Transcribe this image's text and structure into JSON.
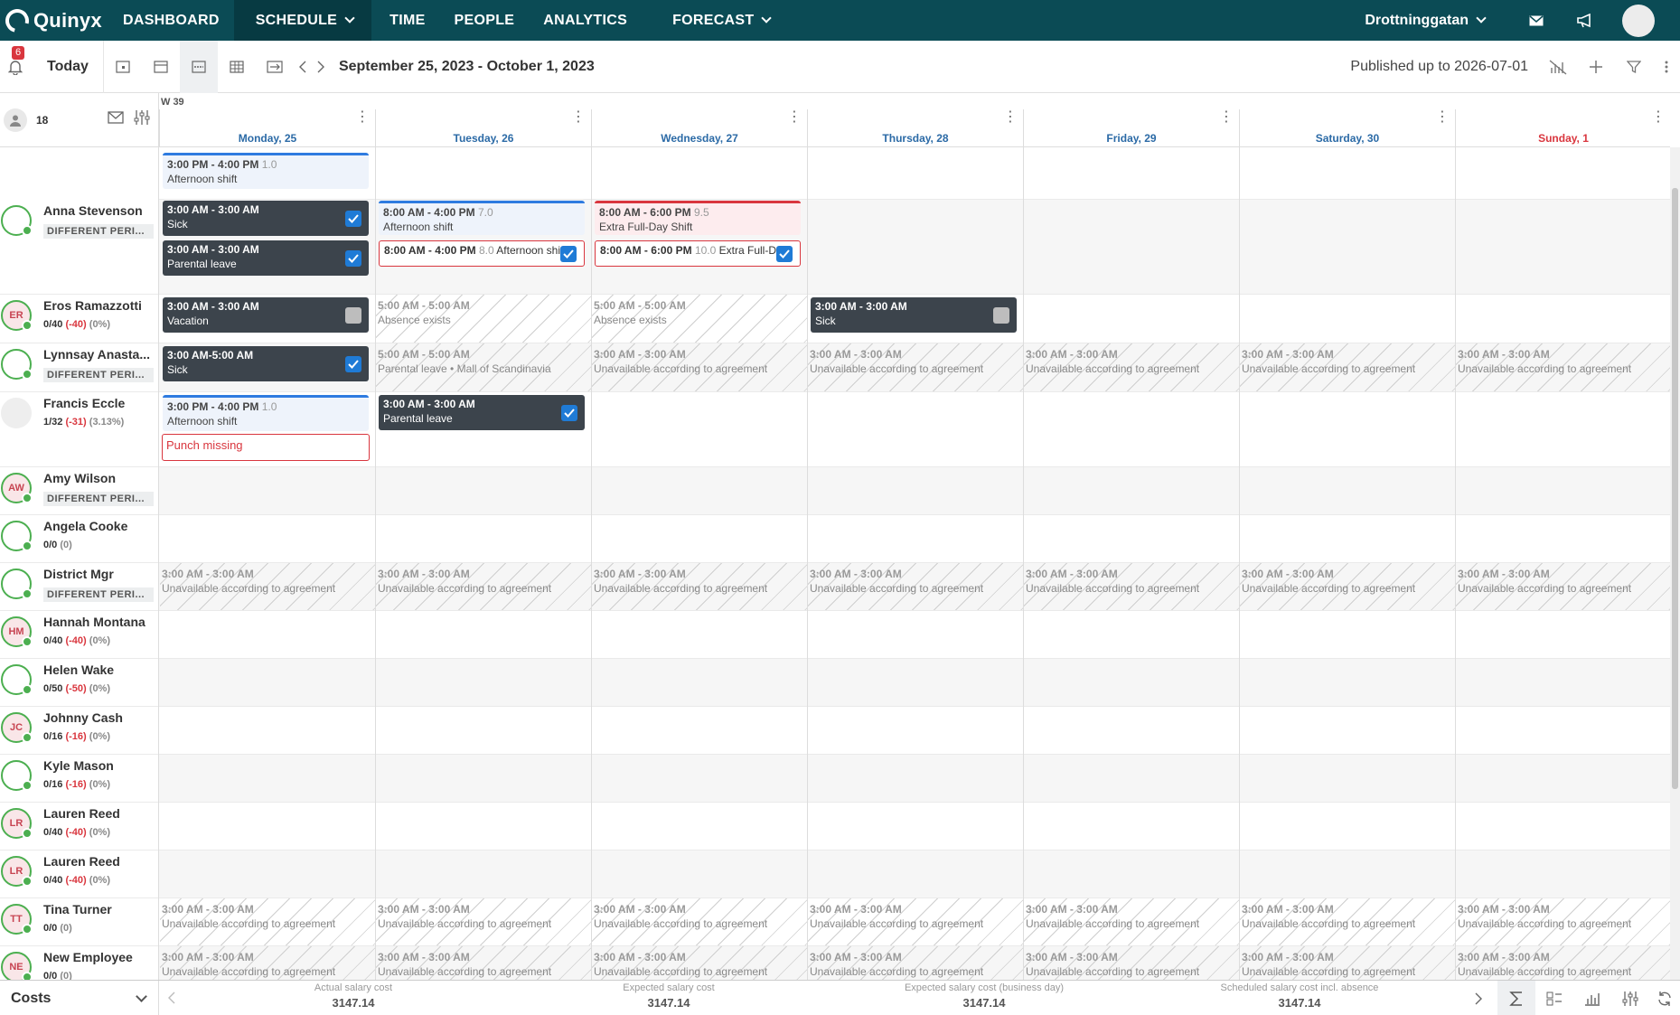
{
  "nav": {
    "logo": "Quinyx",
    "items": [
      "DASHBOARD",
      "SCHEDULE",
      "TIME",
      "PEOPLE",
      "ANALYTICS",
      "FORECAST"
    ],
    "unit": "Drottninggatan"
  },
  "toolbar": {
    "notifications": "6",
    "today": "Today",
    "date_range": "September 25, 2023 - October 1, 2023",
    "published": "Published up to 2026-07-01"
  },
  "week": "W 39",
  "employee_count": "18",
  "days": [
    "Monday, 25",
    "Tuesday, 26",
    "Wednesday, 27",
    "Thursday, 28",
    "Friday, 29",
    "Saturday, 30",
    "Sunday, 1"
  ],
  "employees": [
    {
      "name": "Anna Stevenson",
      "initials": "",
      "sub": "DIFFERENT PERI..."
    },
    {
      "name": "Eros Ramazzotti",
      "initials": "ER",
      "h": "0/40",
      "d": "(-40)",
      "p": "(0%)"
    },
    {
      "name": "Lynnsay Anasta...",
      "initials": "",
      "sub": "DIFFERENT PERI..."
    },
    {
      "name": "Francis Eccle",
      "initials": "",
      "h": "1/32",
      "d": "(-31)",
      "p": "(3.13%)"
    },
    {
      "name": "Amy Wilson",
      "initials": "AW",
      "sub": "DIFFERENT PERI..."
    },
    {
      "name": "Angela Cooke",
      "initials": "",
      "h": "0/0",
      "d": "",
      "p": "(0)"
    },
    {
      "name": "District Mgr",
      "initials": "",
      "sub": "DIFFERENT PERI..."
    },
    {
      "name": "Hannah Montana",
      "initials": "HM",
      "h": "0/40",
      "d": "(-40)",
      "p": "(0%)"
    },
    {
      "name": "Helen Wake",
      "initials": "",
      "h": "0/50",
      "d": "(-50)",
      "p": "(0%)"
    },
    {
      "name": "Johnny Cash",
      "initials": "JC",
      "h": "0/16",
      "d": "(-16)",
      "p": "(0%)"
    },
    {
      "name": "Kyle Mason",
      "initials": "",
      "h": "0/16",
      "d": "(-16)",
      "p": "(0%)"
    },
    {
      "name": "Lauren Reed",
      "initials": "LR",
      "h": "0/40",
      "d": "(-40)",
      "p": "(0%)"
    },
    {
      "name": "Lauren Reed",
      "initials": "LR",
      "h": "0/40",
      "d": "(-40)",
      "p": "(0%)"
    },
    {
      "name": "Tina Turner",
      "initials": "TT",
      "h": "0/0",
      "d": "",
      "p": "(0)"
    },
    {
      "name": "New Employee",
      "initials": "NE",
      "h": "0/0",
      "d": "",
      "p": "(0)"
    }
  ],
  "shifts": {
    "top_mon": {
      "time": "3:00 PM - 4:00 PM",
      "hours": "1.0",
      "label": "Afternoon shift"
    },
    "anna_mon_1": {
      "time": "3:00 AM - 3:00 AM",
      "label": "Sick"
    },
    "anna_mon_2": {
      "time": "3:00 AM - 3:00 AM",
      "label": "Parental leave"
    },
    "anna_tue_1": {
      "time": "8:00 AM - 4:00 PM",
      "hours": "7.0",
      "label": "Afternoon shift"
    },
    "anna_tue_2": {
      "time": "8:00 AM - 4:00 PM",
      "hours": "8.0",
      "label": "Afternoon shi"
    },
    "anna_wed_1": {
      "time": "8:00 AM - 6:00 PM",
      "hours": "9.5",
      "label": "Extra Full-Day Shift"
    },
    "anna_wed_2": {
      "time": "8:00 AM - 6:00 PM",
      "hours": "10.0",
      "label": "Extra Full-D"
    },
    "eros_mon": {
      "time": "3:00 AM - 3:00 AM",
      "label": "Vacation"
    },
    "eros_tue": {
      "time": "5:00 AM - 5:00 AM",
      "label": "Absence exists"
    },
    "eros_wed": {
      "time": "5:00 AM - 5:00 AM",
      "label": "Absence exists"
    },
    "eros_thu": {
      "time": "3:00 AM - 3:00 AM",
      "label": "Sick"
    },
    "lyn_mon": {
      "time": "3:00 AM-5:00 AM",
      "label": "Sick"
    },
    "lyn_tue": {
      "time": "5:00 AM - 5:00 AM",
      "label": "Parental leave • Mall of Scandinavia"
    },
    "francis_mon": {
      "time": "3:00 PM - 4:00 PM",
      "hours": "1.0",
      "label": "Afternoon shift"
    },
    "francis_punch": "Punch missing",
    "francis_tue": {
      "time": "3:00 AM - 3:00 AM",
      "label": "Parental leave"
    }
  },
  "unavailable": {
    "time": "3:00 AM - 3:00 AM",
    "label": "Unavailable according to agreement"
  },
  "footer": {
    "costs": "Costs",
    "stats": [
      {
        "label": "Actual salary cost",
        "value": "3147.14"
      },
      {
        "label": "Expected salary cost",
        "value": "3147.14"
      },
      {
        "label": "Expected salary cost (business day)",
        "value": "3147.14"
      },
      {
        "label": "Scheduled salary cost incl. absence",
        "value": "3147.14"
      }
    ]
  },
  "colors": {
    "nav": "#0b4b55",
    "accent": "#1f7bd6",
    "danger": "#d9363e",
    "dark_shift": "#3c444c"
  }
}
